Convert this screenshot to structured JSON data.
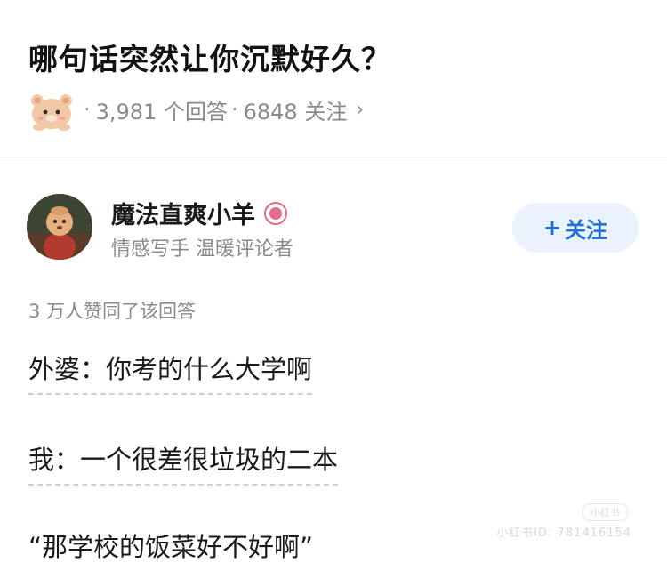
{
  "question": {
    "title": "哪句话突然让你沉默好久？",
    "answers_count": "3,981 个回答",
    "separator": "·",
    "followers_count": "6848 关注",
    "chevron": "›"
  },
  "author": {
    "name": "魔法直爽小羊",
    "description": "情感写手 温暖评论者",
    "follow_plus": "+",
    "follow_label": "关注",
    "avatar_icon": "avatar-character",
    "badge_icon": "creator-badge-icon"
  },
  "answer": {
    "likes": "3 万人赞同了该回答",
    "lines": [
      "外婆：你考的什么大学啊",
      "我：一个很差很垃圾的二本",
      "“那学校的饭菜好不好啊”"
    ]
  },
  "watermark": {
    "tag": "小红书",
    "text": "小红书ID: 781416154"
  },
  "colors": {
    "accent": "#1f6fd6",
    "follow_bg": "#eaf2fd",
    "muted": "#8a8a8a",
    "badge": "#e86a8a"
  }
}
